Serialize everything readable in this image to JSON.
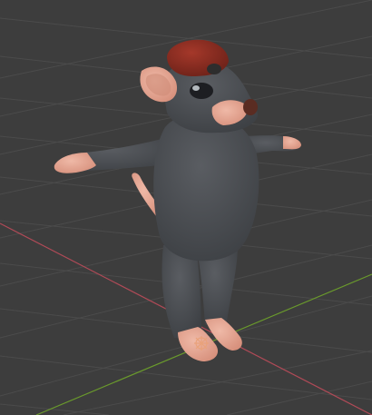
{
  "viewport": {
    "background_color": "#3d3d3d",
    "grid_line_color": "#4b4b4b",
    "x_axis_color": "#b04a57",
    "y_axis_color": "#6a9a2c"
  },
  "scene_object": {
    "name": "rat-character",
    "pose": "t-pose",
    "body_color": "#4a4d52",
    "skin_color": "#e3a896",
    "cap_color": "#8c2e22",
    "nose_color": "#5a2c22"
  },
  "origin_marker": {
    "icon": "object-origin-icon",
    "color": "#e9a27a"
  }
}
